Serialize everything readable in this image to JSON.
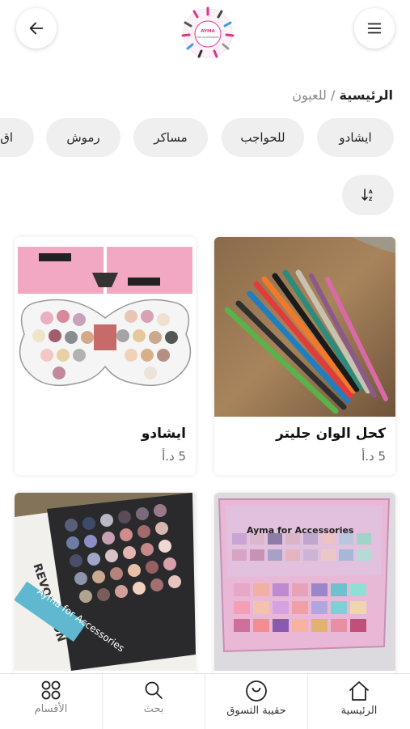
{
  "header": {
    "back_icon": "arrow-left-icon",
    "menu_icon": "hamburger-menu-icon",
    "logo_icon": "ayma-store-logo",
    "logo_text": "AYMA FOR ACCESSORIES"
  },
  "breadcrumb": {
    "home": "الرئيسية",
    "separator": "/",
    "current": "للعيون"
  },
  "chips": [
    {
      "label": "ايشادو"
    },
    {
      "label": "للحواجب"
    },
    {
      "label": "مساكر"
    },
    {
      "label": "رموش"
    },
    {
      "label": "اق"
    }
  ],
  "sort": {
    "icon": "sort-icon"
  },
  "products": [
    {
      "title": "كحل الوان جليتر",
      "price": "5 د.أ",
      "image": "colored-eyeliner-pencils"
    },
    {
      "title": "ايشادو",
      "price": "5 د.أ",
      "image": "butterfly-eyeshadow-palette"
    },
    {
      "title": "",
      "price": "",
      "image": "pastel-eyeshadow-palette",
      "image_caption": "Ayma for Accessories"
    },
    {
      "title": "",
      "price": "",
      "image": "revolution-eyeshadow-palette",
      "image_brand": "REVOLUTION",
      "image_sub": "MAKEUP REVOLUTION",
      "image_tag": "Ayma for Accessories"
    }
  ],
  "bottom_nav": [
    {
      "label": "الرئيسية",
      "icon": "home-icon"
    },
    {
      "label": "حقيبة التسوق",
      "icon": "shopping-bag-icon"
    },
    {
      "label": "بحث",
      "icon": "search-icon"
    },
    {
      "label": "الأقسام",
      "icon": "categories-grid-icon"
    }
  ],
  "colors": {
    "accent": "#e0338a",
    "chip_bg": "#efefef",
    "text": "#1f1f1f"
  }
}
